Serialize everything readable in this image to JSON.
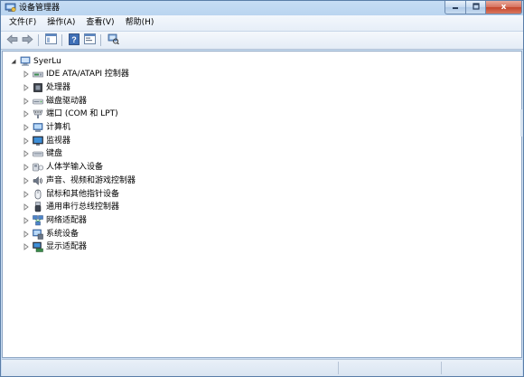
{
  "window": {
    "title": "设备管理器",
    "controls": {
      "minimize_icon": "minimize-icon",
      "maximize_icon": "maximize-icon",
      "close_icon": "close-icon",
      "close_glyph": "x"
    }
  },
  "menubar": {
    "items": [
      "文件(F)",
      "操作(A)",
      "查看(V)",
      "帮助(H)"
    ]
  },
  "toolbar": {
    "buttons": [
      "back-arrow-icon",
      "forward-arrow-icon",
      "show-hide-console-tree-icon",
      "help-icon",
      "properties-icon",
      "scan-hardware-icon"
    ]
  },
  "tree": {
    "root": {
      "label": "SyerLu",
      "expanded": true,
      "icon": "computer-icon"
    },
    "children": [
      {
        "label": "IDE ATA/ATAPI 控制器",
        "icon": "ide-controller-icon"
      },
      {
        "label": "处理器",
        "icon": "processor-icon"
      },
      {
        "label": "磁盘驱动器",
        "icon": "disk-drive-icon"
      },
      {
        "label": "端口 (COM 和 LPT)",
        "icon": "port-icon"
      },
      {
        "label": "计算机",
        "icon": "computer-icon"
      },
      {
        "label": "监视器",
        "icon": "monitor-icon"
      },
      {
        "label": "键盘",
        "icon": "keyboard-icon"
      },
      {
        "label": "人体学输入设备",
        "icon": "hid-icon"
      },
      {
        "label": "声音、视频和游戏控制器",
        "icon": "sound-icon"
      },
      {
        "label": "鼠标和其他指针设备",
        "icon": "mouse-icon"
      },
      {
        "label": "通用串行总线控制器",
        "icon": "usb-icon"
      },
      {
        "label": "网络适配器",
        "icon": "network-adapter-icon"
      },
      {
        "label": "系统设备",
        "icon": "system-device-icon"
      },
      {
        "label": "显示适配器",
        "icon": "display-adapter-icon"
      }
    ]
  },
  "colors": {
    "title_bar": "#b5d1ee",
    "content_bg": "#ffffff",
    "close_button": "#c4452c"
  }
}
